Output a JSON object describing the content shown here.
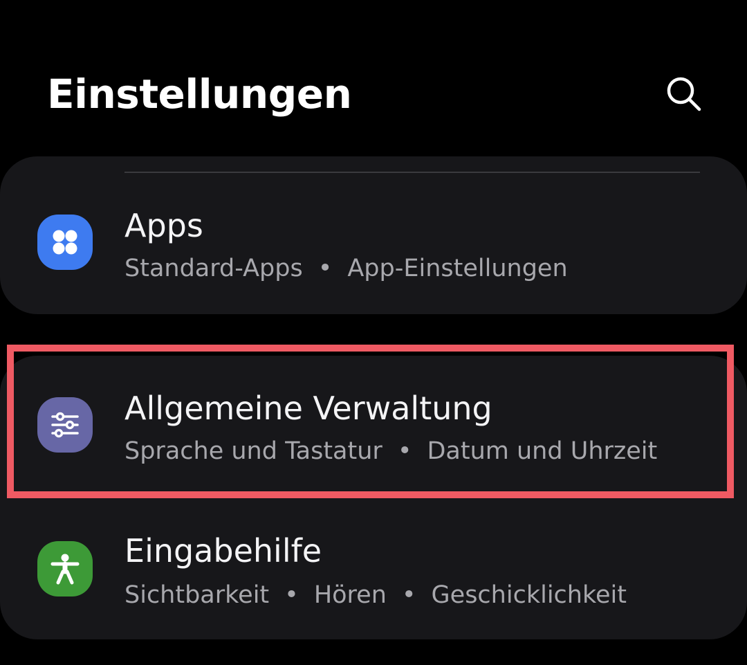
{
  "header": {
    "title": "Einstellungen",
    "search_icon": "search-icon"
  },
  "colors": {
    "background": "#000000",
    "card": "#17171a",
    "apps_icon": "#3e7bf0",
    "general_icon": "#6767a6",
    "accessibility_icon": "#3d9a37",
    "highlight": "#ef5a63"
  },
  "items": [
    {
      "title": "Apps",
      "subtitle_parts": [
        "Standard-Apps",
        "App-Einstellungen"
      ],
      "icon": "apps-grid-icon",
      "separator": "•"
    },
    {
      "title": "Allgemeine Verwaltung",
      "subtitle_parts": [
        "Sprache und Tastatur",
        "Datum und Uhrzeit"
      ],
      "icon": "sliders-icon",
      "separator": "•"
    },
    {
      "title": "Eingabehilfe",
      "subtitle_parts": [
        "Sichtbarkeit",
        "Hören",
        "Geschicklichkeit"
      ],
      "icon": "accessibility-person-icon",
      "separator": "•"
    }
  ]
}
